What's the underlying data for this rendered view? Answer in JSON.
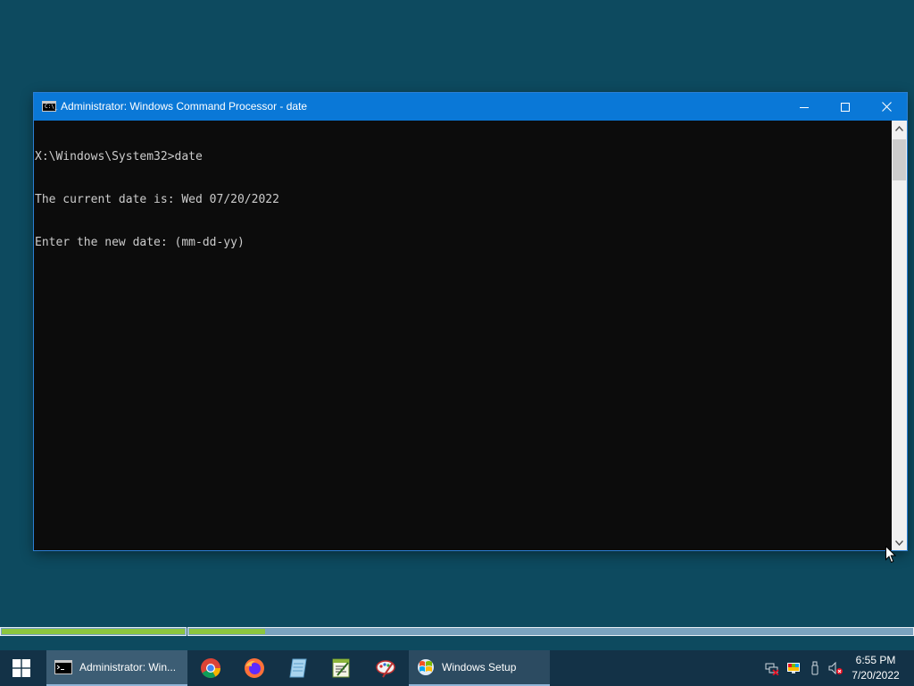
{
  "window": {
    "title": "Administrator: Windows Command Processor - date",
    "icon": "console-icon",
    "icon_glyph": "C:\\_"
  },
  "console": {
    "lines": [
      "X:\\Windows\\System32>date",
      "The current date is: Wed 07/20/2022",
      "Enter the new date: (mm-dd-yy)"
    ]
  },
  "progress": {
    "bar1_fraction": 1.0,
    "bar2_fraction": 0.105
  },
  "taskbar": {
    "start_icon": "windows-logo-icon",
    "cmd_label": "Administrator: Win...",
    "pinned": [
      "chrome-icon",
      "firefox-icon",
      "notes-icon",
      "editor-icon",
      "paint-icon"
    ],
    "setup_label": "Windows Setup"
  },
  "tray": {
    "icons": [
      "network-icon",
      "display-icon",
      "usb-icon",
      "volume-muted-icon"
    ],
    "time": "6:55 PM",
    "date": "7/20/2022"
  },
  "colors": {
    "desktop": "#0d4a5f",
    "titlebar": "#0a78d7",
    "console_bg": "#0c0c0c",
    "console_fg": "#cccccc",
    "progress_fill": "#8bc53f",
    "taskbar": "#133247"
  }
}
